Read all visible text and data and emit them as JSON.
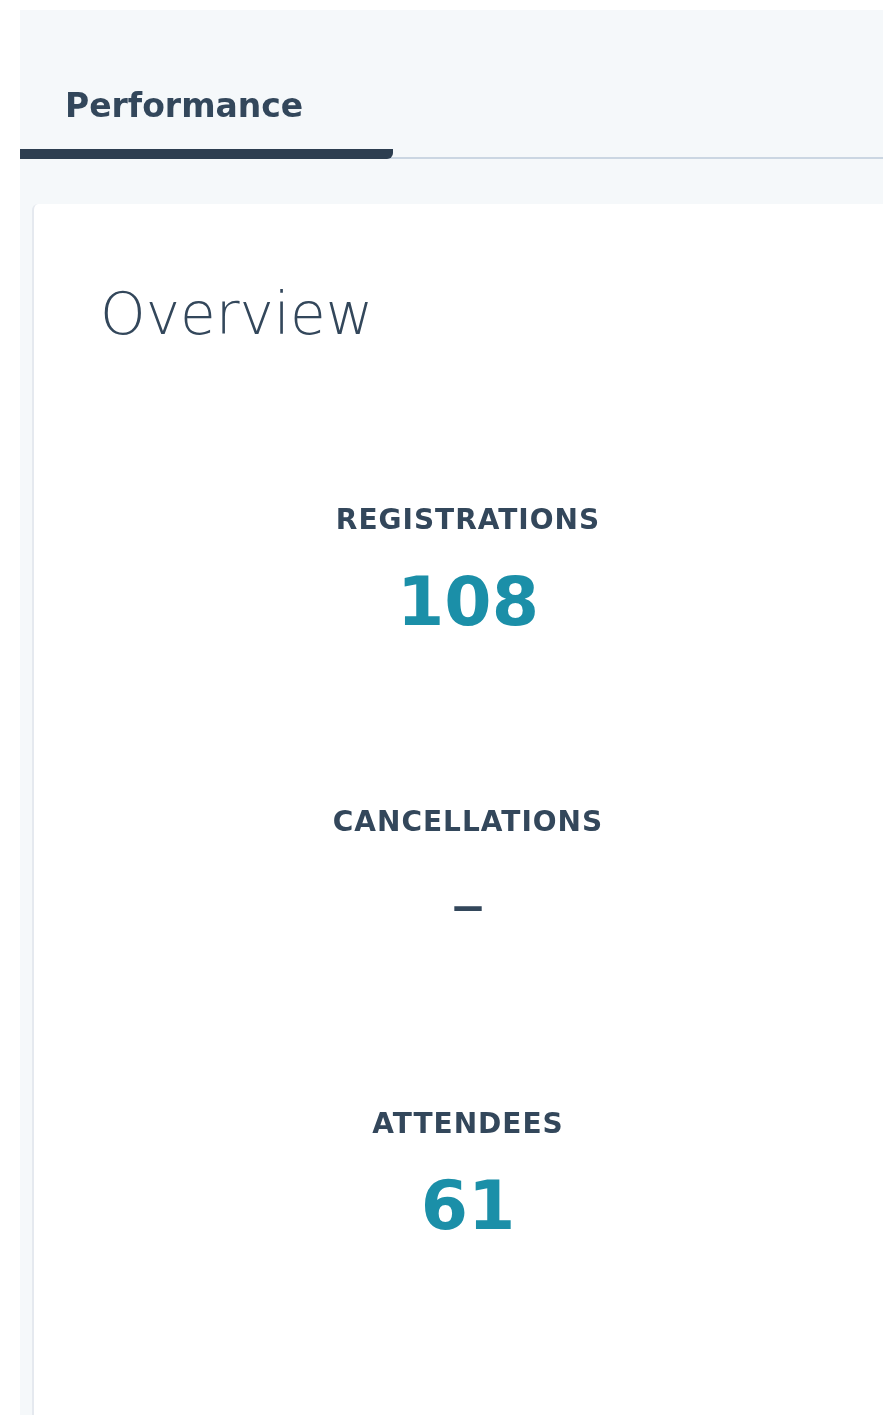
{
  "tabs": [
    {
      "label": "Performance",
      "selected": true
    }
  ],
  "card": {
    "title": "Overview",
    "stats": [
      {
        "label": "REGISTRATIONS",
        "value": "108",
        "kind": "number"
      },
      {
        "label": "CANCELLATIONS",
        "value": "–",
        "kind": "empty"
      },
      {
        "label": "ATTENDEES",
        "value": "61",
        "kind": "number"
      }
    ]
  }
}
